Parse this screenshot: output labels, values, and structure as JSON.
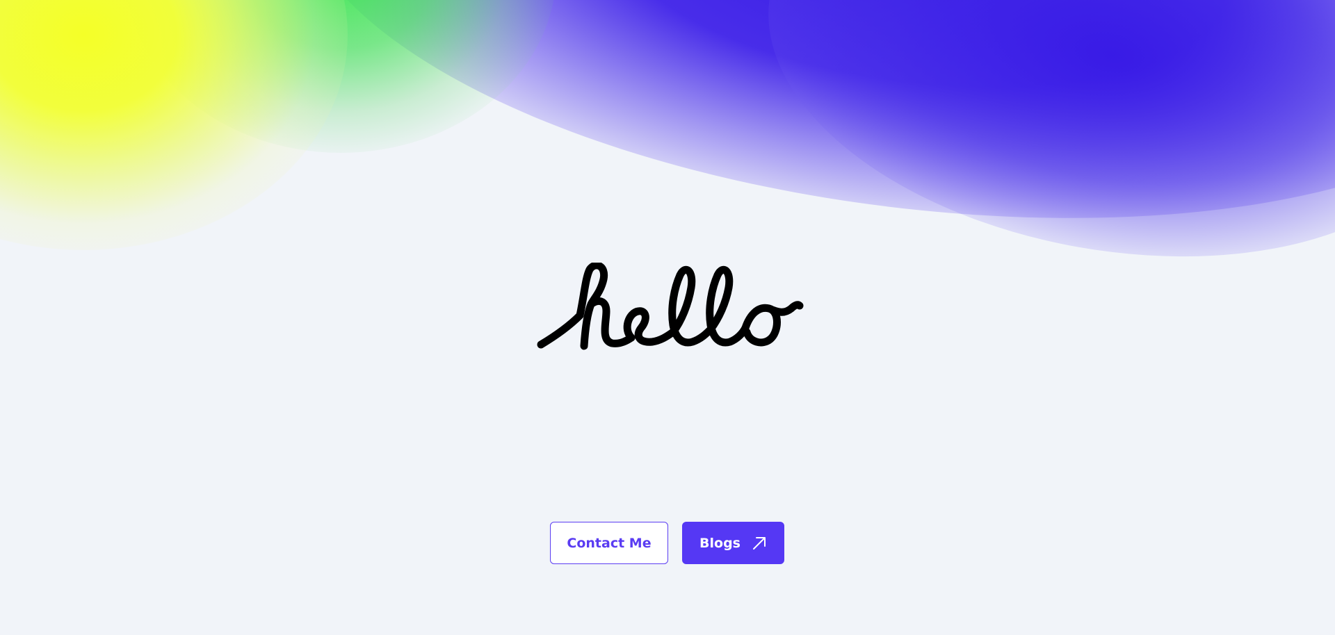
{
  "hero": {
    "greeting": "hello"
  },
  "actions": {
    "contact_label": "Contact Me",
    "blogs_label": "Blogs",
    "blogs_icon": "arrow-up-right-icon"
  },
  "colors": {
    "accent": "#5538F4",
    "background": "#F1F4F9",
    "gradient_yellow": "#F4FF28",
    "gradient_green": "#3CE650",
    "gradient_purple": "#3416E6"
  }
}
